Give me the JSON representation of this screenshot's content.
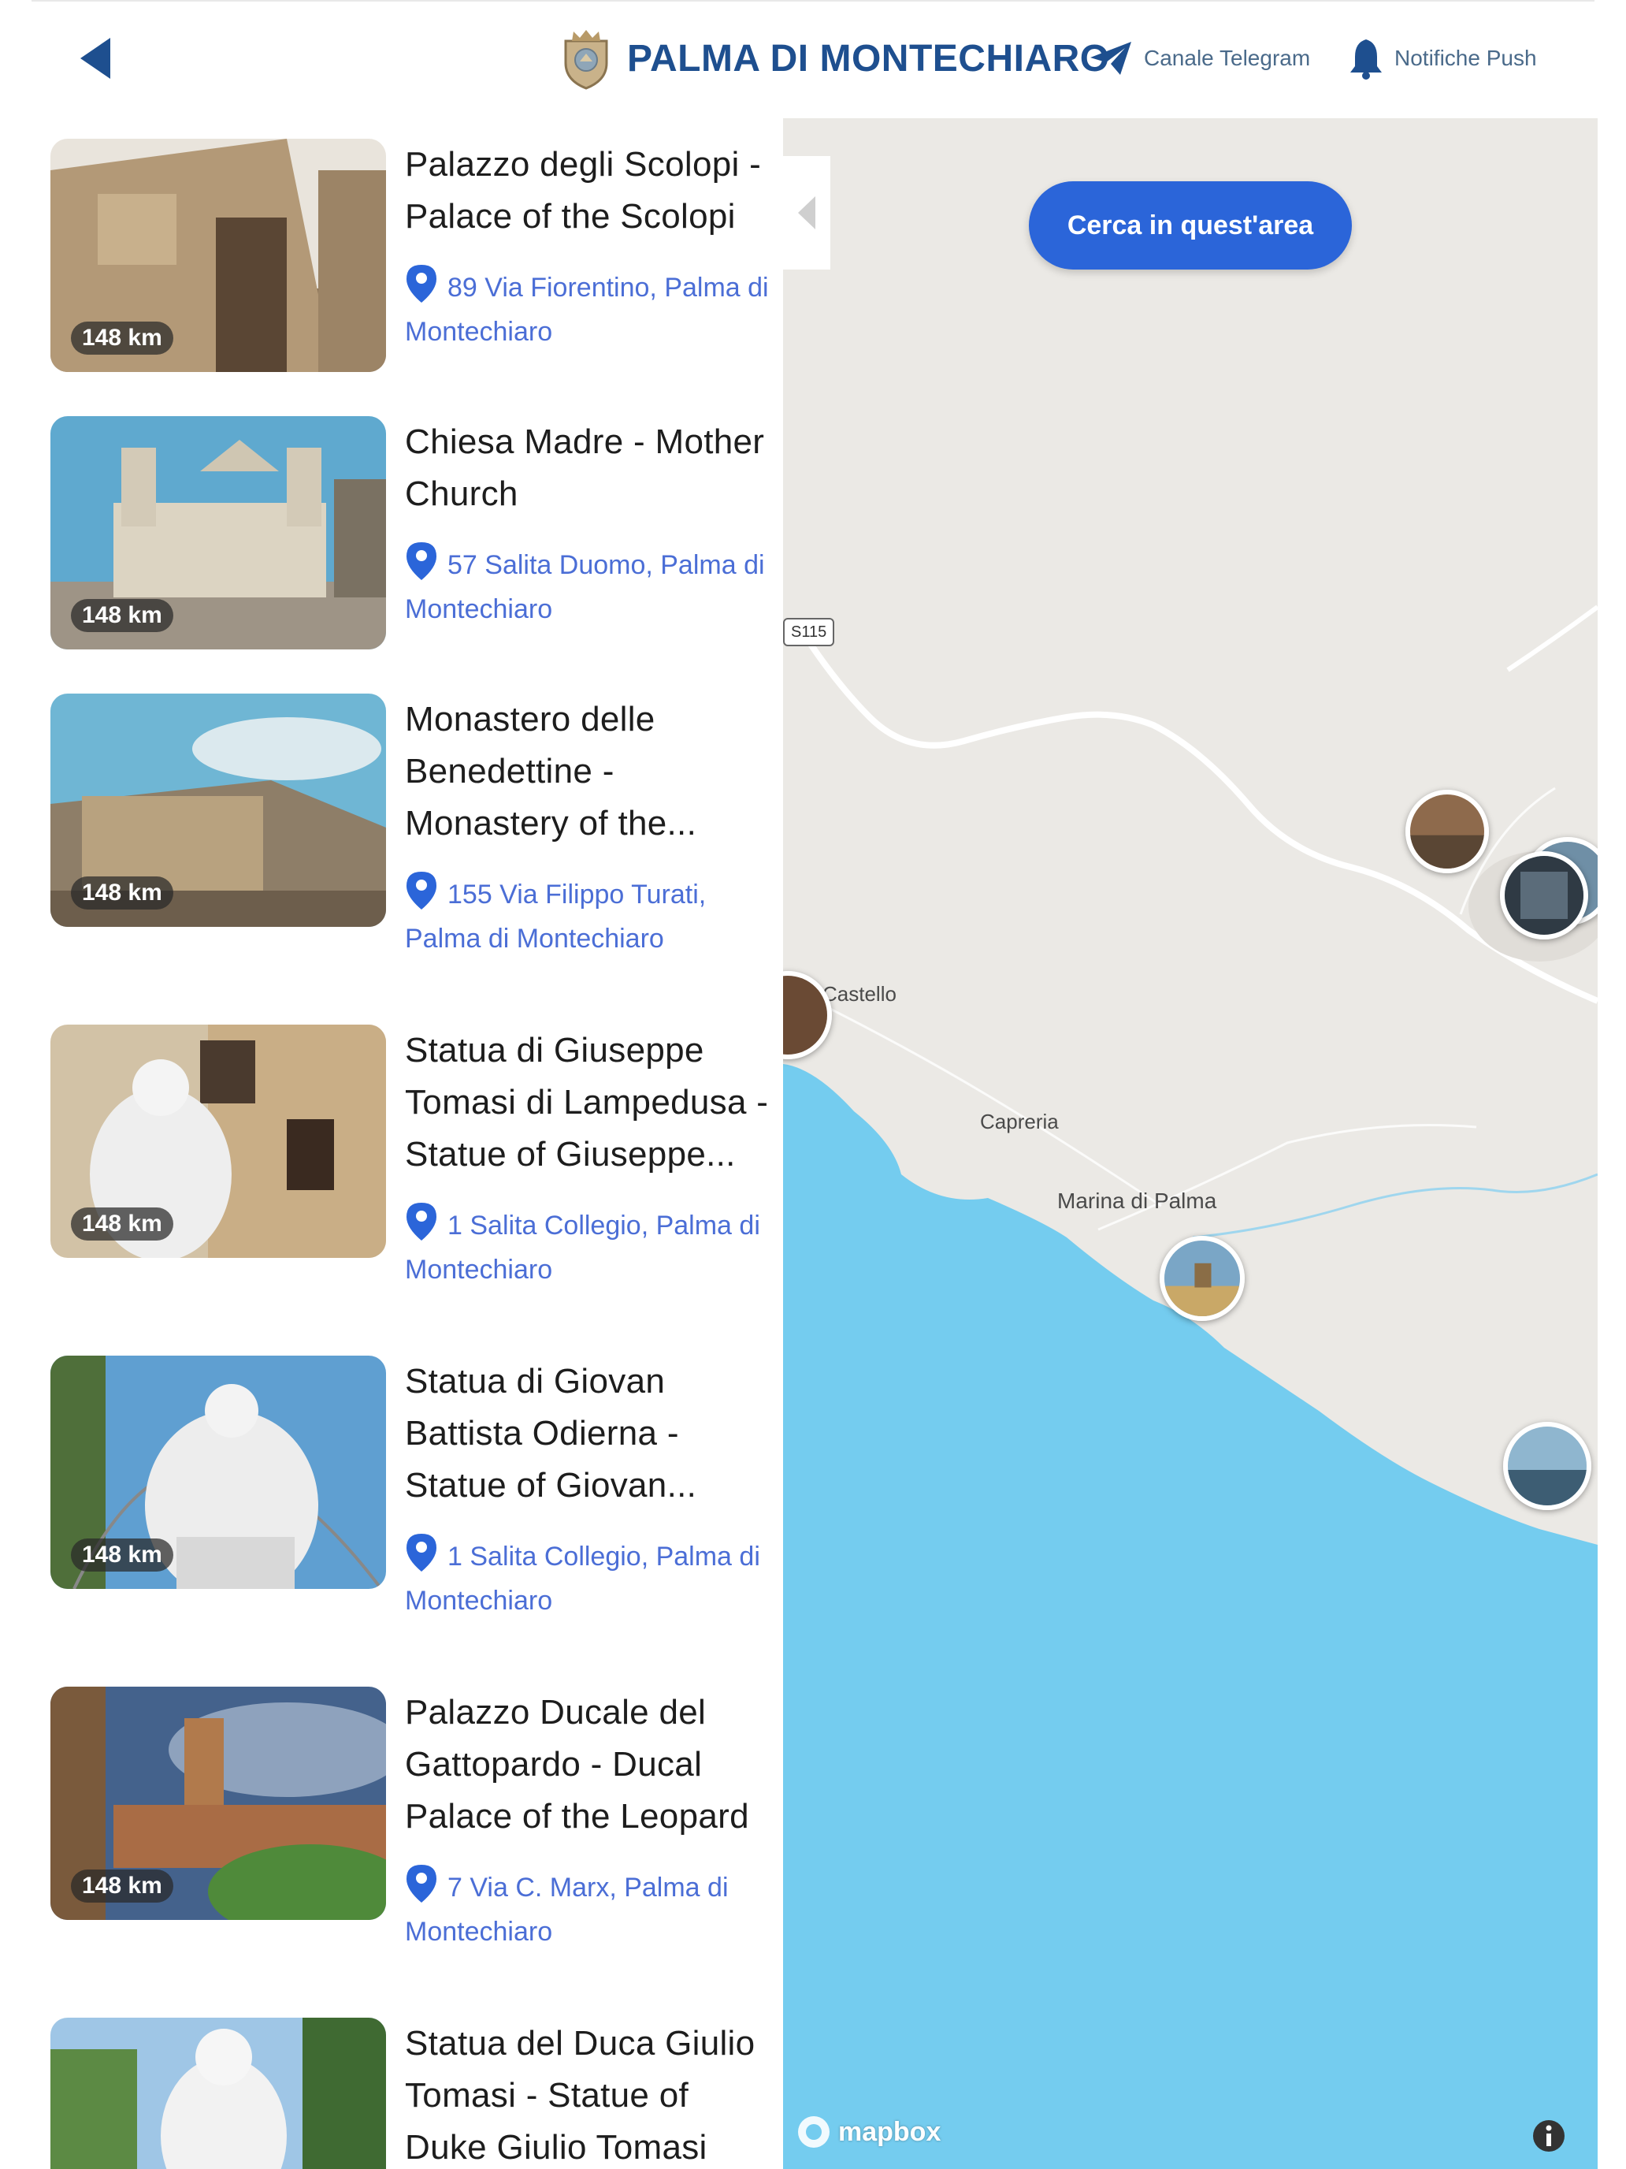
{
  "header": {
    "title": "PALMA DI MONTECHIARO",
    "telegram_label": "Canale Telegram",
    "push_label": "Notifiche Push"
  },
  "list": {
    "items": [
      {
        "title": "Palazzo degli Scolopi - Palace of the Scolopi",
        "address": "89 Via Fiorentino, Palma di Montechiaro",
        "distance": "148 km"
      },
      {
        "title": "Chiesa Madre - Mother Church",
        "address": "57 Salita Duomo, Palma di Montechiaro",
        "distance": "148 km"
      },
      {
        "title": "Monastero delle Benedettine - Monastery of the...",
        "address": "155 Via Filippo Turati, Palma di Montechiaro",
        "distance": "148 km"
      },
      {
        "title": "Statua di Giuseppe Tomasi di Lampedusa - Statue of Giuseppe...",
        "address": "1 Salita Collegio, Palma di Montechiaro",
        "distance": "148 km"
      },
      {
        "title": "Statua di Giovan Battista Odierna - Statue of Giovan...",
        "address": "1 Salita Collegio, Palma di Montechiaro",
        "distance": "148 km"
      },
      {
        "title": "Palazzo Ducale del Gattopardo - Ducal Palace of the Leopard",
        "address": "7 Via C. Marx, Palma di Montechiaro",
        "distance": "148 km"
      },
      {
        "title": "Statua del Duca Giulio Tomasi - Statue of Duke Giulio Tomasi",
        "address": "",
        "distance": ""
      }
    ]
  },
  "map": {
    "search_button": "Cerca in quest'area",
    "road_label": "S115",
    "places": {
      "castello": "Castello",
      "capreria": "Capreria",
      "marina": "Marina di Palma"
    },
    "attribution": "mapbox",
    "colors": {
      "land": "#ebe9e5",
      "sea": "#74ccef",
      "accent": "#2b65d9",
      "brand": "#1e4f8f"
    }
  }
}
